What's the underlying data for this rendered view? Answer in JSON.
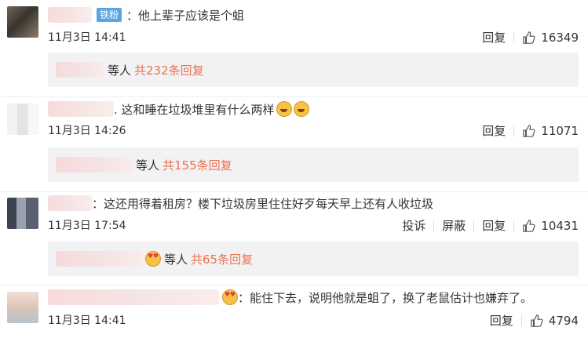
{
  "comments": [
    {
      "badge": "铁粉",
      "text": "：他上辈子应该是个蛆",
      "time": "11月3日 14:41",
      "reply_label": "回复",
      "likes": "16349",
      "thread": {
        "suffix": "等人",
        "count_text": "共232条回复"
      }
    },
    {
      "text": ". 这和睡在垃圾堆里有什么两样",
      "emoji_icon": "laugh-cry-emoji",
      "time": "11月3日 14:26",
      "reply_label": "回复",
      "likes": "11071",
      "thread": {
        "suffix": "等人",
        "count_text": "共155条回复"
      }
    },
    {
      "text": "：这还用得着租房？楼下垃圾房里住住好歹每天早上还有人收垃圾",
      "time": "11月3日 17:54",
      "report_label": "投诉",
      "block_label": "屏蔽",
      "reply_label": "回复",
      "likes": "10431",
      "thread": {
        "suffix": "等人",
        "count_text": "共65条回复",
        "emoji_icon": "love-emoji"
      }
    },
    {
      "text": "：能住下去，说明他就是蛆了，换了老鼠估计也嫌弃了。",
      "emoji_icon": "love-emoji",
      "time": "11月3日 14:41",
      "reply_label": "回复",
      "likes": "4794"
    }
  ],
  "colors": {
    "link": "#eb7350",
    "badge": "#5aa6e0",
    "reply_bg": "#f2f2f5"
  }
}
